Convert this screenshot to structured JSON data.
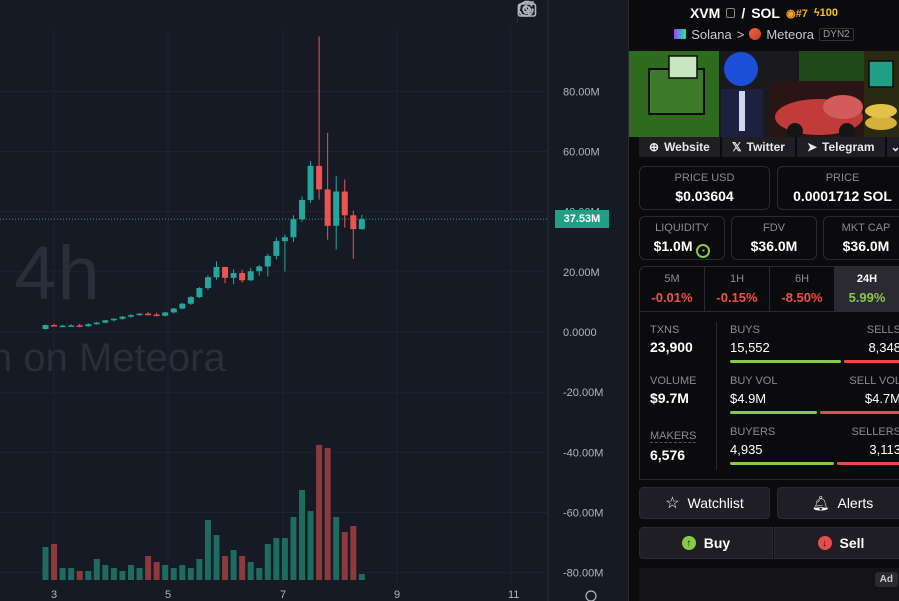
{
  "watermark": {
    "interval": "4h",
    "source": "n on Meteora",
    "comma": ","
  },
  "chart_data": {
    "type": "candlestick",
    "y_axis_labels": [
      "80.00M",
      "60.00M",
      "40.00M",
      "20.00M",
      "0.0000",
      "-20.00M",
      "-40.00M",
      "-60.00M",
      "-80.00M"
    ],
    "x_axis_labels": [
      "3",
      "5",
      "7",
      "9",
      "11"
    ],
    "last_price_label": "37.53M",
    "ylim": [
      -80000000,
      100000000
    ],
    "candles": [
      {
        "o": 1.0,
        "h": 2.5,
        "l": 0.8,
        "c": 2.3,
        "v": 1.1
      },
      {
        "o": 2.3,
        "h": 2.8,
        "l": 1.8,
        "c": 2.0,
        "v": 1.2
      },
      {
        "o": 2.0,
        "h": 2.4,
        "l": 1.7,
        "c": 2.1,
        "v": 0.4
      },
      {
        "o": 2.1,
        "h": 2.6,
        "l": 1.9,
        "c": 2.2,
        "v": 0.4
      },
      {
        "o": 2.2,
        "h": 2.7,
        "l": 1.6,
        "c": 1.9,
        "v": 0.3
      },
      {
        "o": 1.9,
        "h": 2.9,
        "l": 1.8,
        "c": 2.6,
        "v": 0.3
      },
      {
        "o": 2.6,
        "h": 3.4,
        "l": 2.4,
        "c": 3.1,
        "v": 0.7
      },
      {
        "o": 3.1,
        "h": 4.0,
        "l": 2.9,
        "c": 3.9,
        "v": 0.5
      },
      {
        "o": 3.9,
        "h": 4.6,
        "l": 3.5,
        "c": 4.4,
        "v": 0.4
      },
      {
        "o": 4.4,
        "h": 5.3,
        "l": 4.1,
        "c": 5.1,
        "v": 0.3
      },
      {
        "o": 5.1,
        "h": 5.9,
        "l": 4.7,
        "c": 5.6,
        "v": 0.5
      },
      {
        "o": 5.6,
        "h": 6.3,
        "l": 5.4,
        "c": 6.1,
        "v": 0.4
      },
      {
        "o": 6.1,
        "h": 6.6,
        "l": 5.5,
        "c": 5.8,
        "v": 0.8
      },
      {
        "o": 5.8,
        "h": 6.4,
        "l": 5.2,
        "c": 5.4,
        "v": 0.6
      },
      {
        "o": 5.4,
        "h": 6.7,
        "l": 5.1,
        "c": 6.5,
        "v": 0.5
      },
      {
        "o": 6.5,
        "h": 8.0,
        "l": 6.2,
        "c": 7.8,
        "v": 0.4
      },
      {
        "o": 7.8,
        "h": 9.7,
        "l": 7.5,
        "c": 9.4,
        "v": 0.5
      },
      {
        "o": 9.4,
        "h": 12.0,
        "l": 9.0,
        "c": 11.6,
        "v": 0.4
      },
      {
        "o": 11.6,
        "h": 14.9,
        "l": 11.2,
        "c": 14.6,
        "v": 0.7
      },
      {
        "o": 14.6,
        "h": 18.9,
        "l": 14.0,
        "c": 18.2,
        "v": 2.0
      },
      {
        "o": 18.2,
        "h": 23.5,
        "l": 17.4,
        "c": 21.6,
        "v": 1.5
      },
      {
        "o": 21.6,
        "h": 21.7,
        "l": 16.2,
        "c": 18.0,
        "v": 0.8
      },
      {
        "o": 18.0,
        "h": 20.9,
        "l": 15.9,
        "c": 19.6,
        "v": 1.0
      },
      {
        "o": 19.6,
        "h": 20.7,
        "l": 16.4,
        "c": 17.2,
        "v": 0.8
      },
      {
        "o": 17.2,
        "h": 21.3,
        "l": 16.9,
        "c": 20.2,
        "v": 0.6
      },
      {
        "o": 20.2,
        "h": 22.3,
        "l": 18.7,
        "c": 21.8,
        "v": 0.4
      },
      {
        "o": 21.8,
        "h": 26.0,
        "l": 18.5,
        "c": 25.3,
        "v": 1.2
      },
      {
        "o": 25.3,
        "h": 31.4,
        "l": 24.2,
        "c": 30.2,
        "v": 1.4
      },
      {
        "o": 30.2,
        "h": 32.4,
        "l": 20.1,
        "c": 31.5,
        "v": 1.4
      },
      {
        "o": 31.5,
        "h": 38.8,
        "l": 29.9,
        "c": 37.5,
        "v": 2.1
      },
      {
        "o": 37.5,
        "h": 45.0,
        "l": 36.6,
        "c": 43.9,
        "v": 3.0
      },
      {
        "o": 43.9,
        "h": 56.8,
        "l": 42.9,
        "c": 55.2,
        "v": 2.3
      },
      {
        "o": 55.2,
        "h": 98.3,
        "l": 44.0,
        "c": 47.4,
        "v": 4.5
      },
      {
        "o": 47.4,
        "h": 66.2,
        "l": 30.7,
        "c": 35.3,
        "v": 4.4
      },
      {
        "o": 35.3,
        "h": 51.9,
        "l": 27.4,
        "c": 46.7,
        "v": 2.1
      },
      {
        "o": 46.7,
        "h": 50.7,
        "l": 34.7,
        "c": 38.8,
        "v": 1.6
      },
      {
        "o": 38.8,
        "h": 40.3,
        "l": 24.4,
        "c": 34.2,
        "v": 1.8
      },
      {
        "o": 34.2,
        "h": 38.9,
        "l": 34.0,
        "c": 37.5,
        "v": 0.2
      }
    ]
  },
  "pair": {
    "base": "XVM",
    "sep": "/",
    "quote": "SOL",
    "rank": "#7",
    "boosts": "100"
  },
  "chain": {
    "name": "Solana",
    "arrow": ">",
    "dex": "Meteora",
    "tag": "DYN2"
  },
  "links": [
    {
      "label": "Website",
      "icon": "globe-icon"
    },
    {
      "label": "Twitter",
      "icon": "x-icon"
    },
    {
      "label": "Telegram",
      "icon": "telegram-icon"
    }
  ],
  "price_usd": {
    "label": "PRICE USD",
    "value": "$0.03604"
  },
  "price_sol": {
    "label": "PRICE",
    "value": "0.0001712 SOL"
  },
  "liquidity": {
    "label": "LIQUIDITY",
    "value": "$1.0M"
  },
  "fdv": {
    "label": "FDV",
    "value": "$36.0M"
  },
  "mktcap": {
    "label": "MKT CAP",
    "value": "$36.0M"
  },
  "timeframes": [
    {
      "key": "5M",
      "value": "-0.01%",
      "color": "#f04e4e"
    },
    {
      "key": "1H",
      "value": "-0.15%",
      "color": "#f04e4e"
    },
    {
      "key": "6H",
      "value": "-8.50%",
      "color": "#f04e4e"
    },
    {
      "key": "24H",
      "value": "5.99%",
      "color": "#8ac849"
    }
  ],
  "stats": {
    "txns": {
      "label": "TXNS",
      "value": "23,900"
    },
    "volume": {
      "label": "VOLUME",
      "value": "$9.7M"
    },
    "makers": {
      "label": "MAKERS",
      "value": "6,576"
    },
    "buys": {
      "l": "BUYS",
      "r": "SELLS",
      "lv": "15,552",
      "rv": "8,348",
      "ratio": 0.65
    },
    "vol": {
      "l": "BUY VOL",
      "r": "SELL VOL",
      "lv": "$4.9M",
      "rv": "$4.7M",
      "ratio": 0.51
    },
    "buyers": {
      "l": "BUYERS",
      "r": "SELLERS",
      "lv": "4,935",
      "rv": "3,113",
      "ratio": 0.61
    }
  },
  "actions": {
    "watchlist": "Watchlist",
    "alerts": "Alerts",
    "buy": "Buy",
    "sell": "Sell"
  },
  "ad": {
    "badge": "Ad"
  }
}
